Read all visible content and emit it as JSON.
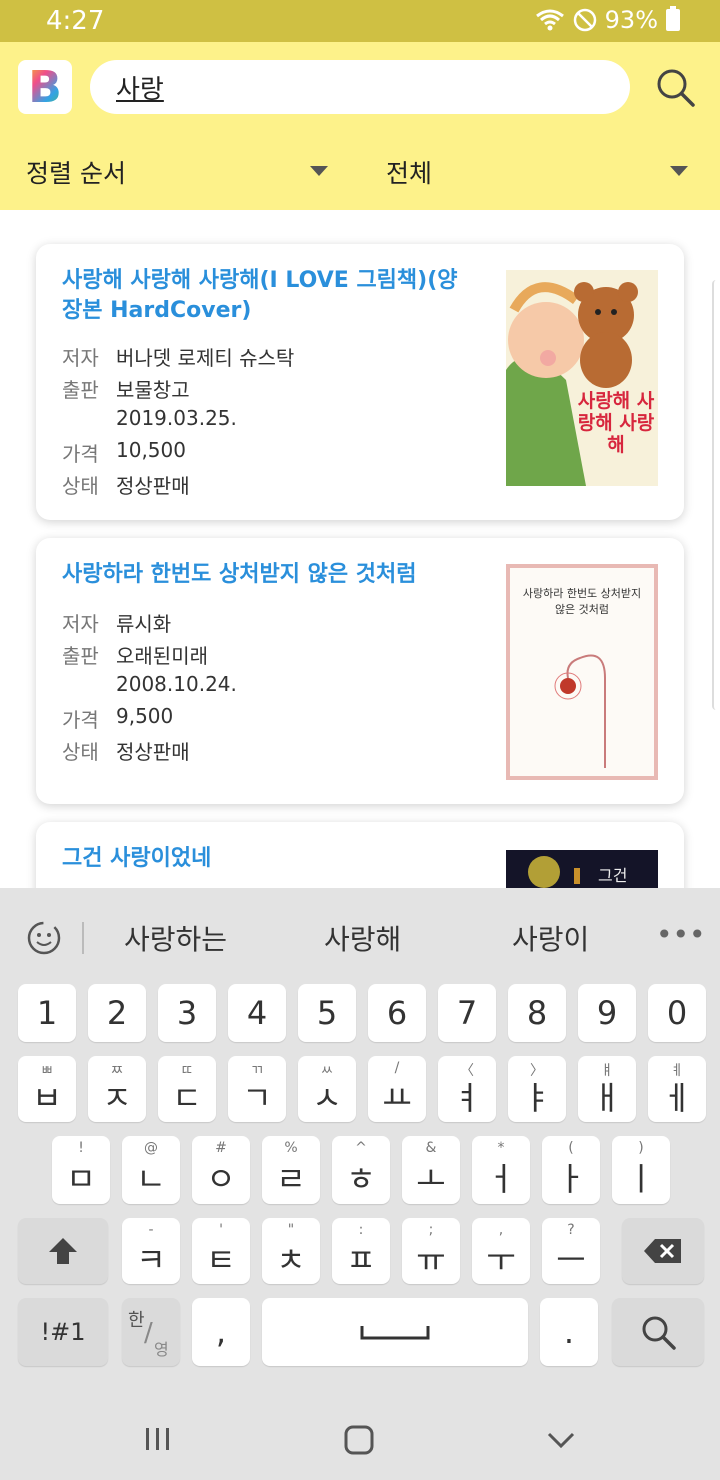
{
  "status": {
    "time": "4:27",
    "battery": "93%"
  },
  "header": {
    "logo_letter": "B",
    "search_value": "사랑",
    "sort_label": "정렬 순서",
    "filter_label": "전체"
  },
  "books": [
    {
      "title": "사랑해 사랑해 사랑해(I LOVE 그림책)(양장본 HardCover)",
      "author_label": "저자",
      "author": "버나뎃 로제티 슈스탁",
      "publisher_label": "출판",
      "publisher": "보물창고",
      "date": "2019.03.25.",
      "price_label": "가격",
      "price": "10,500",
      "status_label": "상태",
      "status": "정상판매",
      "cover_text": "사랑해 사랑해 사랑해"
    },
    {
      "title": "사랑하라 한번도 상처받지 않은 것처럼",
      "author_label": "저자",
      "author": "류시화",
      "publisher_label": "출판",
      "publisher": "오래된미래",
      "date": "2008.10.24.",
      "price_label": "가격",
      "price": "9,500",
      "status_label": "상태",
      "status": "정상판매",
      "cover_text": "사랑하라 한번도 상처받지 않은 것처럼"
    },
    {
      "title": "그건 사랑이었네",
      "cover_text": "그건"
    }
  ],
  "keyboard": {
    "suggestions": [
      "사랑하는",
      "사랑해",
      "사랑이"
    ],
    "row_numbers": [
      "1",
      "2",
      "3",
      "4",
      "5",
      "6",
      "7",
      "8",
      "9",
      "0"
    ],
    "row1": [
      {
        "main": "ㅂ",
        "sub": "ㅃ"
      },
      {
        "main": "ㅈ",
        "sub": "ㅉ"
      },
      {
        "main": "ㄷ",
        "sub": "ㄸ"
      },
      {
        "main": "ㄱ",
        "sub": "ㄲ"
      },
      {
        "main": "ㅅ",
        "sub": "ㅆ"
      },
      {
        "main": "ㅛ",
        "sub": "/"
      },
      {
        "main": "ㅕ",
        "sub": "〈"
      },
      {
        "main": "ㅑ",
        "sub": "〉"
      },
      {
        "main": "ㅐ",
        "sub": "ㅒ"
      },
      {
        "main": "ㅔ",
        "sub": "ㅖ"
      }
    ],
    "row2": [
      {
        "main": "ㅁ",
        "sub": "!"
      },
      {
        "main": "ㄴ",
        "sub": "@"
      },
      {
        "main": "ㅇ",
        "sub": "#"
      },
      {
        "main": "ㄹ",
        "sub": "%"
      },
      {
        "main": "ㅎ",
        "sub": "^"
      },
      {
        "main": "ㅗ",
        "sub": "&"
      },
      {
        "main": "ㅓ",
        "sub": "*"
      },
      {
        "main": "ㅏ",
        "sub": "("
      },
      {
        "main": "ㅣ",
        "sub": ")"
      }
    ],
    "row3": [
      {
        "main": "ㅋ",
        "sub": "-"
      },
      {
        "main": "ㅌ",
        "sub": "'"
      },
      {
        "main": "ㅊ",
        "sub": "\""
      },
      {
        "main": "ㅍ",
        "sub": ":"
      },
      {
        "main": "ㅠ",
        "sub": ";"
      },
      {
        "main": "ㅜ",
        "sub": ","
      },
      {
        "main": "ㅡ",
        "sub": "?"
      }
    ],
    "symbols_label": "!#1",
    "lang_top": "한",
    "lang_bottom": "영",
    "comma": ",",
    "period": "."
  },
  "colors": {
    "accent_title": "#2a8fdb",
    "header_bg": "#fdf28a",
    "status_bg": "#cfc043"
  }
}
